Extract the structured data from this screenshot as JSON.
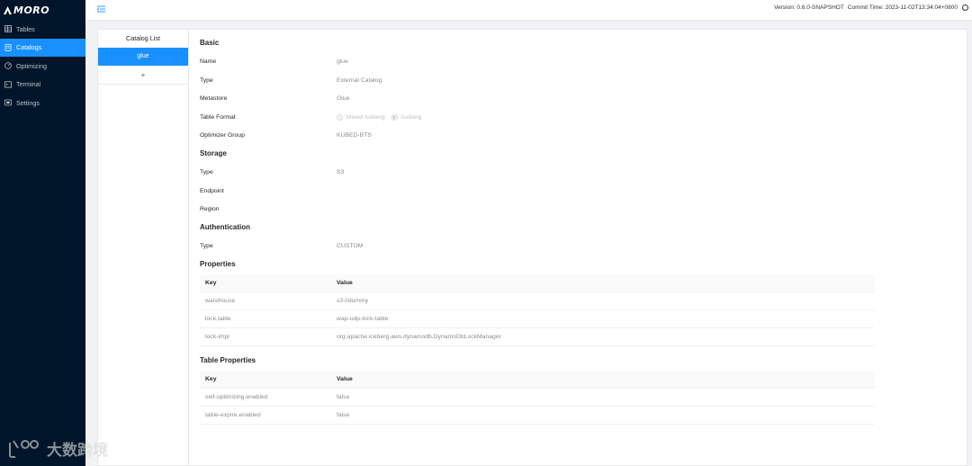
{
  "app": {
    "logo_text": "MORO"
  },
  "sidebar": {
    "items": [
      {
        "label": "Tables",
        "icon": "table-icon",
        "active": false
      },
      {
        "label": "Catalogs",
        "icon": "book-icon",
        "active": true
      },
      {
        "label": "Optimizing",
        "icon": "gauge-icon",
        "active": false
      },
      {
        "label": "Terminal",
        "icon": "terminal-icon",
        "active": false
      },
      {
        "label": "Settings",
        "icon": "settings-icon",
        "active": false
      }
    ]
  },
  "header": {
    "version": "Version: 0.6.0-SNAPSHOT",
    "commit_time": "Commit Time: 2023-11-02T13:34:04+0800"
  },
  "catalog_list": {
    "title": "Catalog List",
    "items": [
      "glue"
    ],
    "add_label": "+"
  },
  "basic": {
    "title": "Basic",
    "name_label": "Name",
    "name_value": "glue",
    "type_label": "Type",
    "type_value": "External Catalog",
    "metastore_label": "Metastore",
    "metastore_value": "Glue",
    "table_format_label": "Table Format",
    "table_format_options": [
      "Mixed Iceberg",
      "Iceberg"
    ],
    "table_format_selected": "Iceberg",
    "optimizer_group_label": "Optimizer Group",
    "optimizer_group_value": "KUBED-BTS"
  },
  "storage": {
    "title": "Storage",
    "type_label": "Type",
    "type_value": "S3",
    "endpoint_label": "Endpoint",
    "endpoint_value": "",
    "region_label": "Region",
    "region_value": ""
  },
  "authentication": {
    "title": "Authentication",
    "type_label": "Type",
    "type_value": "CUSTOM"
  },
  "properties": {
    "title": "Properties",
    "key_header": "Key",
    "value_header": "Value",
    "rows": [
      {
        "key": "warehouse",
        "value": "s3://dummy"
      },
      {
        "key": "lock.table",
        "value": "wap-udp-lock-table"
      },
      {
        "key": "lock-impl",
        "value": "org.apache.iceberg.aws.dynamodb.DynamoDbLockManager"
      }
    ]
  },
  "table_properties": {
    "title": "Table Properties",
    "key_header": "Key",
    "value_header": "Value",
    "rows": [
      {
        "key": "self-optimizing.enabled",
        "value": "false"
      },
      {
        "key": "table-expire.enabled",
        "value": "false"
      }
    ]
  },
  "watermark": {
    "text": "大数跨境"
  },
  "colors": {
    "sidebar_bg": "#001529",
    "accent": "#1890ff"
  }
}
